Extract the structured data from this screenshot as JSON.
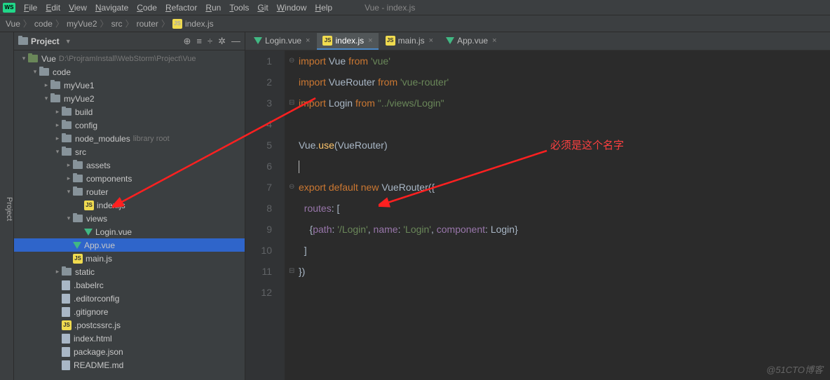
{
  "window_title": "Vue - index.js",
  "menu": [
    "File",
    "Edit",
    "View",
    "Navigate",
    "Code",
    "Refactor",
    "Run",
    "Tools",
    "Git",
    "Window",
    "Help"
  ],
  "breadcrumb": [
    "Vue",
    "code",
    "myVue2",
    "src",
    "router",
    "index.js"
  ],
  "panel": {
    "title": "Project"
  },
  "tree": [
    {
      "depth": 0,
      "arrow": "▾",
      "icon": "folder-root",
      "label": "Vue",
      "hint": "D:\\ProjramInstall\\WebStorm\\Project\\Vue"
    },
    {
      "depth": 1,
      "arrow": "▾",
      "icon": "folder",
      "label": "code"
    },
    {
      "depth": 2,
      "arrow": "▸",
      "icon": "folder",
      "label": "myVue1"
    },
    {
      "depth": 2,
      "arrow": "▾",
      "icon": "folder",
      "label": "myVue2"
    },
    {
      "depth": 3,
      "arrow": "▸",
      "icon": "folder",
      "label": "build"
    },
    {
      "depth": 3,
      "arrow": "▸",
      "icon": "folder",
      "label": "config"
    },
    {
      "depth": 3,
      "arrow": "▸",
      "icon": "folder",
      "label": "node_modules",
      "hint": "library root"
    },
    {
      "depth": 3,
      "arrow": "▾",
      "icon": "folder",
      "label": "src"
    },
    {
      "depth": 4,
      "arrow": "▸",
      "icon": "folder",
      "label": "assets"
    },
    {
      "depth": 4,
      "arrow": "▸",
      "icon": "folder",
      "label": "components"
    },
    {
      "depth": 4,
      "arrow": "▾",
      "icon": "folder",
      "label": "router"
    },
    {
      "depth": 5,
      "arrow": "",
      "icon": "js",
      "label": "index.js"
    },
    {
      "depth": 4,
      "arrow": "▾",
      "icon": "folder",
      "label": "views"
    },
    {
      "depth": 5,
      "arrow": "",
      "icon": "vue",
      "label": "Login.vue"
    },
    {
      "depth": 4,
      "arrow": "",
      "icon": "vue",
      "label": "App.vue",
      "selected": true
    },
    {
      "depth": 4,
      "arrow": "",
      "icon": "js",
      "label": "main.js"
    },
    {
      "depth": 3,
      "arrow": "▸",
      "icon": "folder",
      "label": "static"
    },
    {
      "depth": 3,
      "arrow": "",
      "icon": "file",
      "label": ".babelrc"
    },
    {
      "depth": 3,
      "arrow": "",
      "icon": "file",
      "label": ".editorconfig"
    },
    {
      "depth": 3,
      "arrow": "",
      "icon": "file",
      "label": ".gitignore"
    },
    {
      "depth": 3,
      "arrow": "",
      "icon": "js",
      "label": ".postcssrc.js"
    },
    {
      "depth": 3,
      "arrow": "",
      "icon": "file",
      "label": "index.html"
    },
    {
      "depth": 3,
      "arrow": "",
      "icon": "file",
      "label": "package.json"
    },
    {
      "depth": 3,
      "arrow": "",
      "icon": "file",
      "label": "README.md"
    }
  ],
  "tabs": [
    {
      "icon": "vue",
      "label": "Login.vue"
    },
    {
      "icon": "js",
      "label": "index.js",
      "active": true
    },
    {
      "icon": "js",
      "label": "main.js"
    },
    {
      "icon": "vue",
      "label": "App.vue"
    }
  ],
  "code_lines": [
    {
      "n": 1,
      "html": "<span class='fold'>⊖</span><span class='kw'>import</span> <span class='id'>Vue</span> <span class='kw'>from</span> <span class='str'>'vue'</span>"
    },
    {
      "n": 2,
      "html": "<span class='kw'>import</span> <span class='id'>VueRouter</span> <span class='kw'>from</span> <span class='str'>'vue-router'</span>"
    },
    {
      "n": 3,
      "html": "<span class='fold'>⊟</span><span class='kw'>import</span> <span class='id'>Login</span> <span class='kw'>from</span> <span class='str'>\"../views/Login\"</span>"
    },
    {
      "n": 4,
      "html": ""
    },
    {
      "n": 5,
      "html": "<span class='id'>Vue</span>.<span class='fn'>use</span>(<span class='id'>VueRouter</span>)"
    },
    {
      "n": 6,
      "html": "<span class='caret'></span>"
    },
    {
      "n": 7,
      "html": "<span class='fold'>⊖</span><span class='kw'>export</span> <span class='kw'>default</span> <span class='kw'>new</span> <span class='id'>VueRouter</span>({"
    },
    {
      "n": 8,
      "html": "&nbsp;&nbsp;<span class='prop'>routes</span>: ["
    },
    {
      "n": 9,
      "html": "&nbsp;&nbsp;&nbsp;&nbsp;{<span class='prop'>path</span>: <span class='str'>'/Login'</span>, <span class='prop'>name</span>: <span class='str'>'Login'</span>, <span class='prop'>component</span>: <span class='id'>Login</span>}"
    },
    {
      "n": 10,
      "html": "&nbsp;&nbsp;]"
    },
    {
      "n": 11,
      "html": "<span class='fold'>⊟</span>})"
    },
    {
      "n": 12,
      "html": ""
    }
  ],
  "annotation_text": "必须是这个名字",
  "watermark": "@51CTO博客",
  "sidebar_label": "Project"
}
